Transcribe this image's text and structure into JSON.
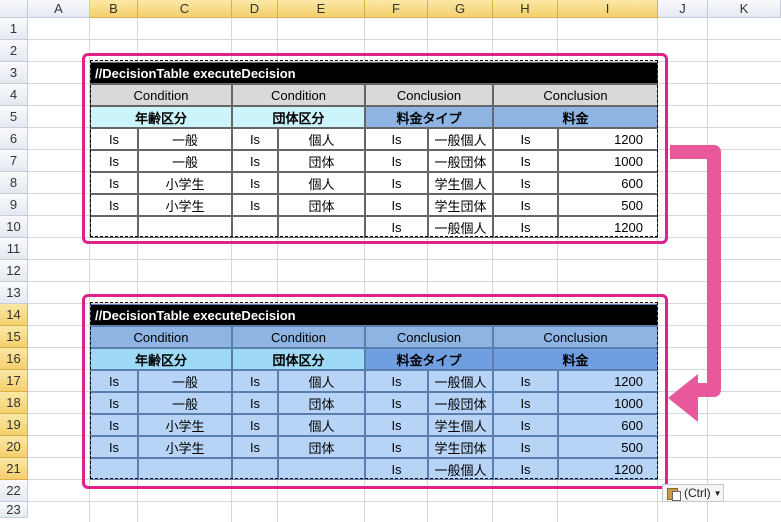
{
  "columns": [
    "A",
    "B",
    "C",
    "D",
    "E",
    "F",
    "G",
    "H",
    "I",
    "J",
    "K"
  ],
  "rows": [
    "1",
    "2",
    "3",
    "4",
    "5",
    "6",
    "7",
    "8",
    "9",
    "10",
    "11",
    "12",
    "13",
    "14",
    "15",
    "16",
    "17",
    "18",
    "19",
    "20",
    "21",
    "22",
    "23"
  ],
  "source_table": {
    "title": "//DecisionTable executeDecision",
    "headers": [
      "Condition",
      "Condition",
      "Conclusion",
      "Conclusion"
    ],
    "keys": [
      "年齢区分",
      "団体区分",
      "料金タイプ",
      "料金"
    ],
    "rows": [
      [
        "Is",
        "一般",
        "Is",
        "個人",
        "Is",
        "一般個人",
        "Is",
        "1200"
      ],
      [
        "Is",
        "一般",
        "Is",
        "団体",
        "Is",
        "一般団体",
        "Is",
        "1000"
      ],
      [
        "Is",
        "小学生",
        "Is",
        "個人",
        "Is",
        "学生個人",
        "Is",
        "600"
      ],
      [
        "Is",
        "小学生",
        "Is",
        "団体",
        "Is",
        "学生団体",
        "Is",
        "500"
      ],
      [
        "",
        "",
        "",
        "",
        "Is",
        "一般個人",
        "Is",
        "1200"
      ]
    ]
  },
  "pasted_table": {
    "title": "//DecisionTable executeDecision",
    "headers": [
      "Condition",
      "Condition",
      "Conclusion",
      "Conclusion"
    ],
    "keys": [
      "年齢区分",
      "団体区分",
      "料金タイプ",
      "料金"
    ],
    "rows": [
      [
        "Is",
        "一般",
        "Is",
        "個人",
        "Is",
        "一般個人",
        "Is",
        "1200"
      ],
      [
        "Is",
        "一般",
        "Is",
        "団体",
        "Is",
        "一般団体",
        "Is",
        "1000"
      ],
      [
        "Is",
        "小学生",
        "Is",
        "個人",
        "Is",
        "学生個人",
        "Is",
        "600"
      ],
      [
        "Is",
        "小学生",
        "Is",
        "団体",
        "Is",
        "学生団体",
        "Is",
        "500"
      ],
      [
        "",
        "",
        "",
        "",
        "Is",
        "一般個人",
        "Is",
        "1200"
      ]
    ]
  },
  "paste_options": {
    "label": "(Ctrl)"
  },
  "colors": {
    "frame": "#e0218a",
    "arrow": "#e9589a",
    "title_bg": "#000000"
  }
}
